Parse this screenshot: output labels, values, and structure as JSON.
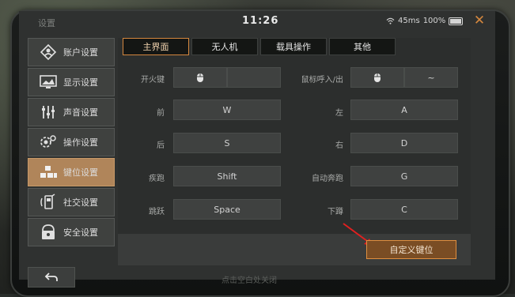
{
  "header": {
    "title": "设置",
    "time": "11:26",
    "signal": "45ms",
    "battery": "100%"
  },
  "sidebar": {
    "items": [
      {
        "label": "账户设置",
        "icon": "account-icon"
      },
      {
        "label": "显示设置",
        "icon": "display-icon"
      },
      {
        "label": "声音设置",
        "icon": "sound-icon"
      },
      {
        "label": "操作设置",
        "icon": "operation-icon"
      },
      {
        "label": "键位设置",
        "icon": "keyboard-icon",
        "active": true
      },
      {
        "label": "社交设置",
        "icon": "social-icon"
      },
      {
        "label": "安全设置",
        "icon": "security-icon"
      }
    ]
  },
  "tabs": [
    {
      "label": "主界面",
      "active": true
    },
    {
      "label": "无人机"
    },
    {
      "label": "载具操作"
    },
    {
      "label": "其他"
    }
  ],
  "bindings": {
    "fire": {
      "label": "开火键",
      "left": "",
      "right": ""
    },
    "mouse": {
      "label": "鼠标呼入/出",
      "left": "",
      "right": "~"
    },
    "forward": {
      "label": "前",
      "key": "W"
    },
    "left": {
      "label": "左",
      "key": "A"
    },
    "back": {
      "label": "后",
      "key": "S"
    },
    "right": {
      "label": "右",
      "key": "D"
    },
    "sprint": {
      "label": "疾跑",
      "key": "Shift"
    },
    "autorun": {
      "label": "自动奔跑",
      "key": "G"
    },
    "jump": {
      "label": "跳跃",
      "key": "Space"
    },
    "crouch": {
      "label": "下蹲",
      "key": "C"
    }
  },
  "custom_button": "自定义键位",
  "hint": "点击空白处关闭",
  "colors": {
    "accent": "#d4873e",
    "active_sidebar": "#b0855a"
  }
}
